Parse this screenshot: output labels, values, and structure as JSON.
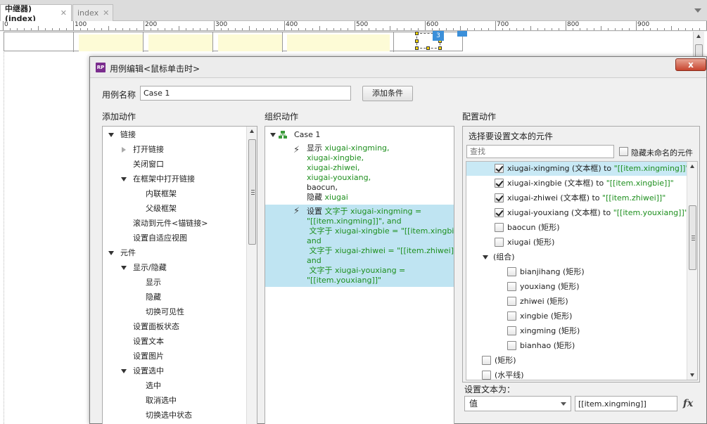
{
  "tabs": [
    {
      "label": "中继器) (index)",
      "close": "✕"
    },
    {
      "label": "index",
      "close": "✕"
    }
  ],
  "ruler": {
    "marks": [
      "0",
      "100",
      "200",
      "300",
      "400",
      "500",
      "600",
      "700",
      "800",
      "900"
    ]
  },
  "canvas": {
    "badge": "3"
  },
  "dialog": {
    "icon": "RP",
    "title": "用例编辑<鼠标单击时>",
    "close": "x",
    "case_name_label": "用例名称",
    "case_name_value": "Case 1",
    "add_condition": "添加条件",
    "add_actions_label": "添加动作",
    "organize_actions_label": "组织动作",
    "configure_actions_label": "配置动作"
  },
  "add_actions": {
    "items": [
      {
        "label": "链接",
        "level": 0,
        "expander": "open"
      },
      {
        "label": "打开链接",
        "level": 1,
        "expander": "closed"
      },
      {
        "label": "关闭窗口",
        "level": 1,
        "expander": "none"
      },
      {
        "label": "在框架中打开链接",
        "level": 1,
        "expander": "open"
      },
      {
        "label": "内联框架",
        "level": 2,
        "expander": "none"
      },
      {
        "label": "父级框架",
        "level": 2,
        "expander": "none"
      },
      {
        "label": "滚动到元件<锚链接>",
        "level": 1,
        "expander": "none"
      },
      {
        "label": "设置自适应视图",
        "level": 1,
        "expander": "none"
      },
      {
        "label": "元件",
        "level": 0,
        "expander": "open"
      },
      {
        "label": "显示/隐藏",
        "level": 1,
        "expander": "open"
      },
      {
        "label": "显示",
        "level": 2,
        "expander": "none"
      },
      {
        "label": "隐藏",
        "level": 2,
        "expander": "none"
      },
      {
        "label": "切换可见性",
        "level": 2,
        "expander": "none"
      },
      {
        "label": "设置面板状态",
        "level": 1,
        "expander": "none"
      },
      {
        "label": "设置文本",
        "level": 1,
        "expander": "none"
      },
      {
        "label": "设置图片",
        "level": 1,
        "expander": "none"
      },
      {
        "label": "设置选中",
        "level": 1,
        "expander": "open"
      },
      {
        "label": "选中",
        "level": 2,
        "expander": "none"
      },
      {
        "label": "取消选中",
        "level": 2,
        "expander": "none"
      },
      {
        "label": "切换选中状态",
        "level": 2,
        "expander": "none"
      }
    ]
  },
  "organize": {
    "case_label": "Case 1",
    "action1": {
      "verb1": "显示 ",
      "targets1": "xiugai-xingming,\nxiugai-xingbie,\nxiugai-zhiwei,\nxiugai-youxiang,",
      "plain": "baocun,",
      "verb2": "隐藏 ",
      "targets2": "xiugai"
    },
    "action2": {
      "verb": "设置 ",
      "text": "文字于 xiugai-xingming =\n\"[[item.xingming]]\", and\n 文字于 xiugai-xingbie = \"[[item.xingbie]]\",\nand\n 文字于 xiugai-zhiwei = \"[[item.zhiwei]]\",\nand\n 文字于 xiugai-youxiang =\n\"[[item.youxiang]]\""
    }
  },
  "configure": {
    "subtitle": "选择要设置文本的元件",
    "search_placeholder": "查找",
    "hide_unnamed_label": "隐藏未命名的元件",
    "rows": [
      {
        "label": "xiugai-xingming (文本框) to ",
        "value": "\"[[item.xingming]]\"",
        "checked": true,
        "level": 1,
        "selected": true
      },
      {
        "label": "xiugai-xingbie (文本框) to ",
        "value": "\"[[item.xingbie]]\"",
        "checked": true,
        "level": 1
      },
      {
        "label": "xiugai-zhiwei (文本框) to ",
        "value": "\"[[item.zhiwei]]\"",
        "checked": true,
        "level": 1
      },
      {
        "label": "xiugai-youxiang (文本框) to ",
        "value": "\"[[item.youxiang]]\"",
        "checked": true,
        "level": 1
      },
      {
        "label": "baocun (矩形)",
        "value": "",
        "checked": false,
        "level": 1
      },
      {
        "label": "xiugai (矩形)",
        "value": "",
        "checked": false,
        "level": 1
      },
      {
        "label": "(组合)",
        "value": "",
        "group": true,
        "level": 1
      },
      {
        "label": "bianjihang (矩形)",
        "value": "",
        "checked": false,
        "level": 2
      },
      {
        "label": "youxiang (矩形)",
        "value": "",
        "checked": false,
        "level": 2
      },
      {
        "label": "zhiwei (矩形)",
        "value": "",
        "checked": false,
        "level": 2
      },
      {
        "label": "xingbie (矩形)",
        "value": "",
        "checked": false,
        "level": 2
      },
      {
        "label": "xingming (矩形)",
        "value": "",
        "checked": false,
        "level": 2
      },
      {
        "label": "bianhao (矩形)",
        "value": "",
        "checked": false,
        "level": 2
      },
      {
        "label": "(矩形)",
        "value": "",
        "checked": false,
        "level": 0
      },
      {
        "label": "(水平线)",
        "value": "",
        "checked": false,
        "level": 0
      }
    ],
    "set_text_as_label": "设置文本为：",
    "set_type_value": "值",
    "set_text_value": "[[item.xingming]]",
    "fx": "fx"
  },
  "colors": {
    "selected_row": "#c9e9f5",
    "action_highlight": "#bfe4f2",
    "value_green": "#1e8f1e"
  }
}
